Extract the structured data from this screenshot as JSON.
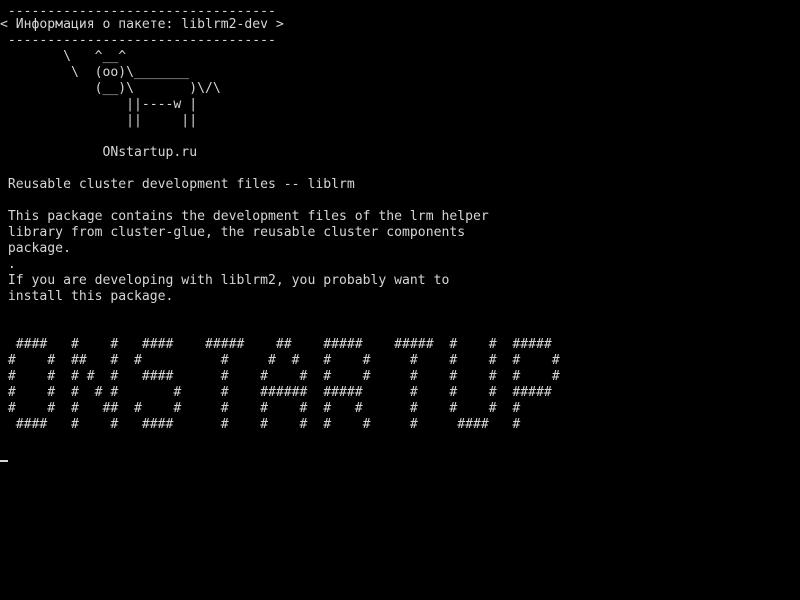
{
  "screen": {
    "lines": [
      " ----------------------------------",
      "< Информация о пакете: liblrm2-dev >",
      " ----------------------------------",
      "        \\   ^__^",
      "         \\  (oo)\\_______",
      "            (__)\\       )\\/\\",
      "                ||----w |",
      "                ||     ||",
      "",
      "             ONstartup.ru",
      "",
      " Reusable cluster development files -- liblrm",
      "",
      " This package contains the development files of the lrm helper",
      " library from cluster-glue, the reusable cluster components",
      " package.",
      " .",
      " If you are developing with liblrm2, you probably want to",
      " install this package.",
      "",
      "",
      "",
      "  ####   #    #   ####    #####    ##    #####    #####  #    #  #####",
      " #    #  ##   #  #          #     #  #   #    #     #    #    #  #    #",
      " #    #  # #  #   ####      #    #    #  #    #     #    #    #  #    #",
      " #    #  #  # #       #     #    ######  #####      #    #    #  #####",
      " #    #  #   ##  #    #     #    #    #  #   #      #    #    #  #",
      "  ####   #    #   ####      #    #    #  #    #     #     ####   #"
    ],
    "text_color": "#d6d6d6",
    "background_color": "#000000"
  }
}
